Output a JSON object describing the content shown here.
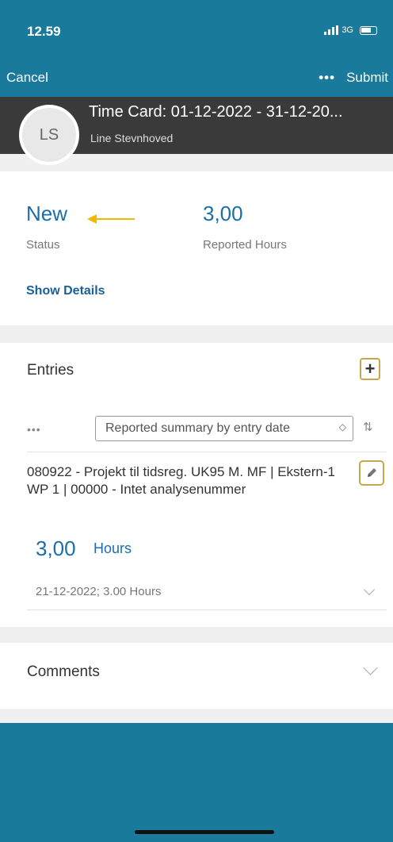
{
  "status_bar": {
    "time": "12.59",
    "network": "3G"
  },
  "nav": {
    "cancel": "Cancel",
    "more": "•••",
    "submit": "Submit"
  },
  "header": {
    "avatar_initials": "LS",
    "title": "Time Card: 01-12-2022 - 31-12-20...",
    "subtitle": "Line Stevnhoved"
  },
  "summary": {
    "status_value": "New",
    "status_label": "Status",
    "hours_value": "3,00",
    "hours_label": "Reported Hours",
    "show_details": "Show Details"
  },
  "entries": {
    "title": "Entries",
    "add_icon": "plus-icon",
    "toolbar_more": "•••",
    "view_select": "Reported summary by entry date",
    "sort_icon": "sort-icon",
    "items": [
      {
        "description": "080922 - Projekt til tidsreg. UK95 M. MF | Ekstern-1 WP 1 | 00000 - Intet analysenummer",
        "hours_value": "3,00",
        "hours_unit": "Hours",
        "detail": "21-12-2022; 3.00 Hours"
      }
    ]
  },
  "comments": {
    "title": "Comments"
  },
  "colors": {
    "brand_blue": "#1a7a9b",
    "accent_gold": "#c8a74a",
    "value_blue": "#1b6ea8",
    "annotation_arrow": "#f5b800"
  }
}
